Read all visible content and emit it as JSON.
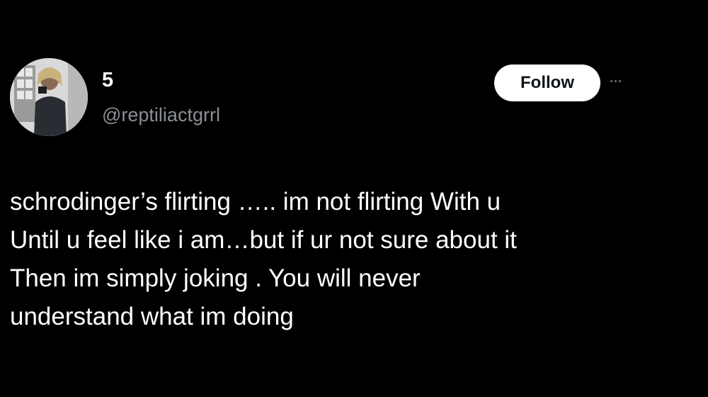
{
  "author": {
    "display_name": "5",
    "handle": "@reptiliactgrrl",
    "avatar_icon": "profile-photo"
  },
  "actions": {
    "follow_label": "Follow",
    "more_icon": "more-options-icon"
  },
  "tweet": {
    "lines": [
      "schrodinger’s flirting ….. im not flirting With u",
      "Until u feel like i am…but if ur not sure about it",
      "Then im simply joking . You will never",
      "understand what im doing"
    ]
  },
  "colors": {
    "background": "#000000",
    "text": "#ffffff",
    "secondary_text": "#8b8f94",
    "follow_bg": "#ffffff",
    "follow_text": "#0f1419"
  }
}
